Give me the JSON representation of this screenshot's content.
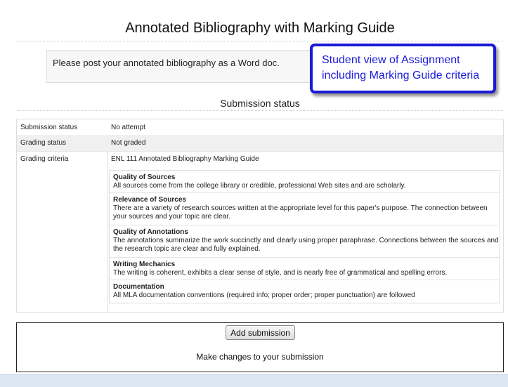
{
  "page": {
    "title": "Annotated Bibliography with Marking Guide",
    "intro": "Please post your annotated bibliography as a Word doc."
  },
  "callout": {
    "line1": "Student view of Assignment",
    "line2": "including Marking Guide criteria"
  },
  "status": {
    "heading": "Submission status",
    "rows": [
      {
        "label": "Submission status",
        "value": "No attempt"
      },
      {
        "label": "Grading status",
        "value": "Not graded"
      },
      {
        "label": "Grading criteria",
        "value": "ENL 111 Annotated Bibliography Marking Guide"
      }
    ]
  },
  "criteria": [
    {
      "name": "Quality of Sources",
      "description": "All sources come from the college library or credible, professional Web sites and are scholarly."
    },
    {
      "name": "Relevance of Sources",
      "description": "There are a variety of research sources written at the appropriate level for this paper's purpose. The connection between your sources and your topic are clear."
    },
    {
      "name": "Quality of Annotations",
      "description": "The annotations summarize the work succinctly and clearly using proper paraphrase. Connections between the sources and the research topic are clear and fully explained."
    },
    {
      "name": "Writing Mechanics",
      "description": "The writing is coherent, exhibits a clear sense of style, and is nearly free of grammatical and spelling errors."
    },
    {
      "name": "Documentation",
      "description": "All MLA documentation conventions (required info; proper order; proper punctuation) are followed"
    }
  ],
  "submission": {
    "button_label": "Add submission",
    "help_text": "Make changes to your submission"
  },
  "colors": {
    "callout_border": "#1a1ad6",
    "callout_text": "#1b1bd8",
    "footer": "#dbe6f3"
  }
}
